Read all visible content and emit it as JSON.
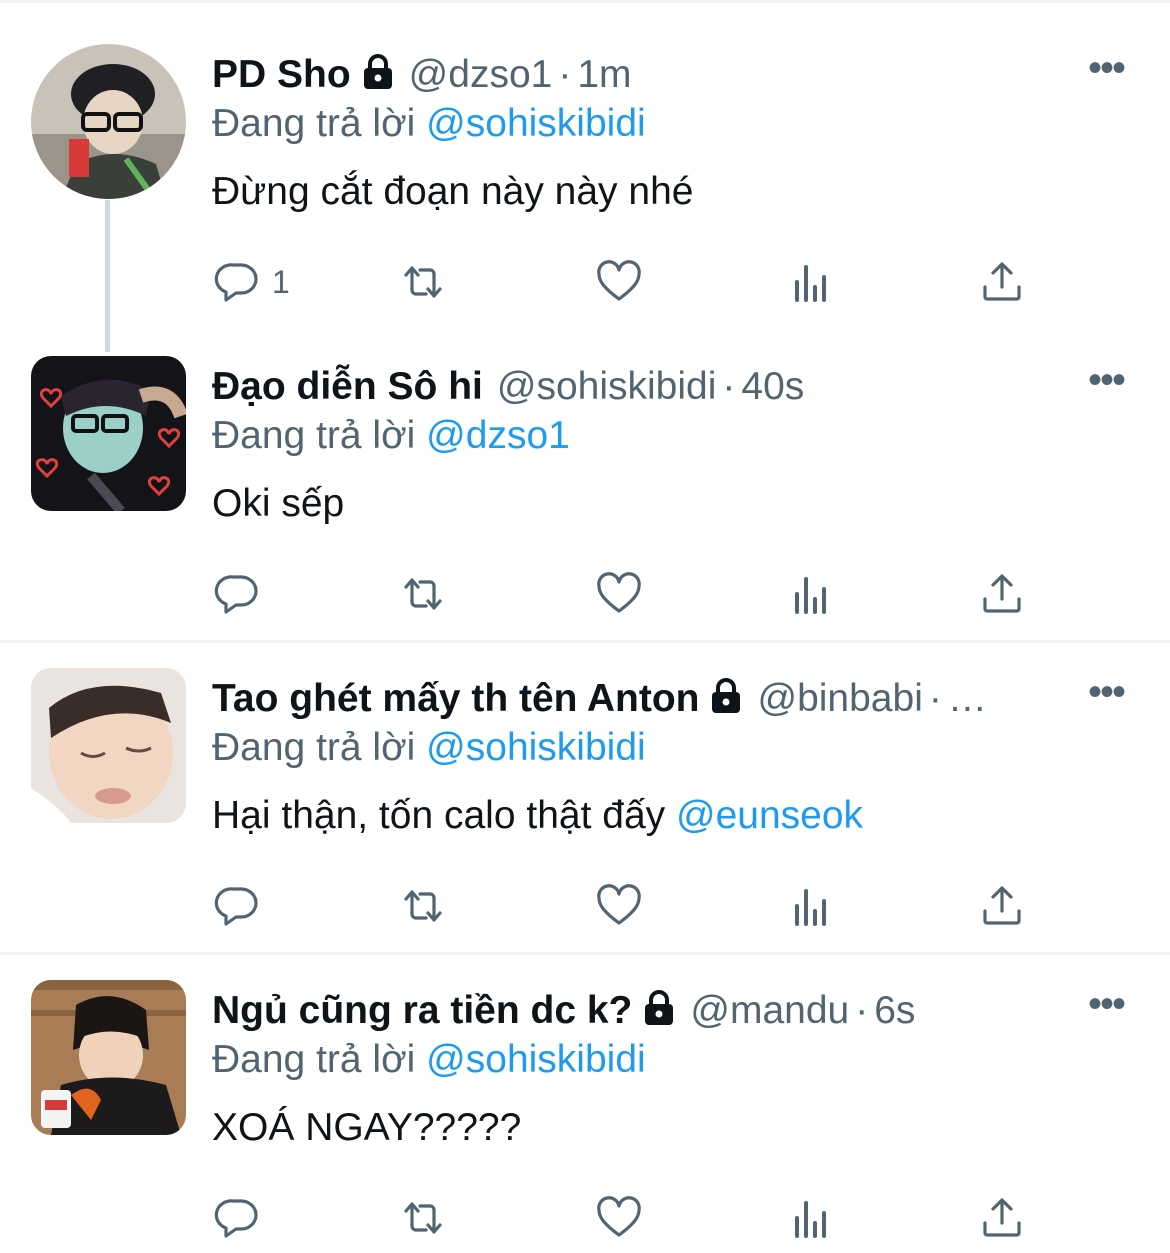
{
  "ui": {
    "reply_prefix": "Đang trả lời",
    "dot": "·",
    "more": "•••"
  },
  "tweets": [
    {
      "name": "PD Sho",
      "handle": "@dzso1",
      "time": "1m",
      "reply_to": "@sohiskibidi",
      "text": "Đừng cắt đoạn này này nhé",
      "reply_count": "1",
      "protected": true
    },
    {
      "name": "Đạo diễn Sô hi",
      "handle": "@sohiskibidi",
      "time": "40s",
      "reply_to": "@dzso1",
      "text": "Oki sếp",
      "reply_count": "",
      "protected": false
    },
    {
      "name": "Tao ghét mấy th tên Anton",
      "handle": "@binbabi",
      "time": "…",
      "reply_to": "@sohiskibidi",
      "text": "Hại thận, tốn calo thật đấy",
      "text_mention": "@eunseok",
      "reply_count": "",
      "protected": true
    },
    {
      "name": "Ngủ cũng ra tiền dc k?",
      "handle": "@mandu",
      "time": "6s",
      "reply_to": "@sohiskibidi",
      "text": "XOÁ NGAY?????",
      "reply_count": "",
      "protected": true
    }
  ],
  "icons": {
    "reply": "speech-bubble-icon",
    "retweet": "retweet-icon",
    "like": "heart-icon",
    "views": "bar-chart-icon",
    "share": "share-icon",
    "lock": "lock-icon",
    "more": "more-icon"
  },
  "colors": {
    "text": "#0f1419",
    "muted": "#536471",
    "link": "#1d9bf0",
    "divider": "#eff3f4",
    "thread": "#cfd9de"
  }
}
